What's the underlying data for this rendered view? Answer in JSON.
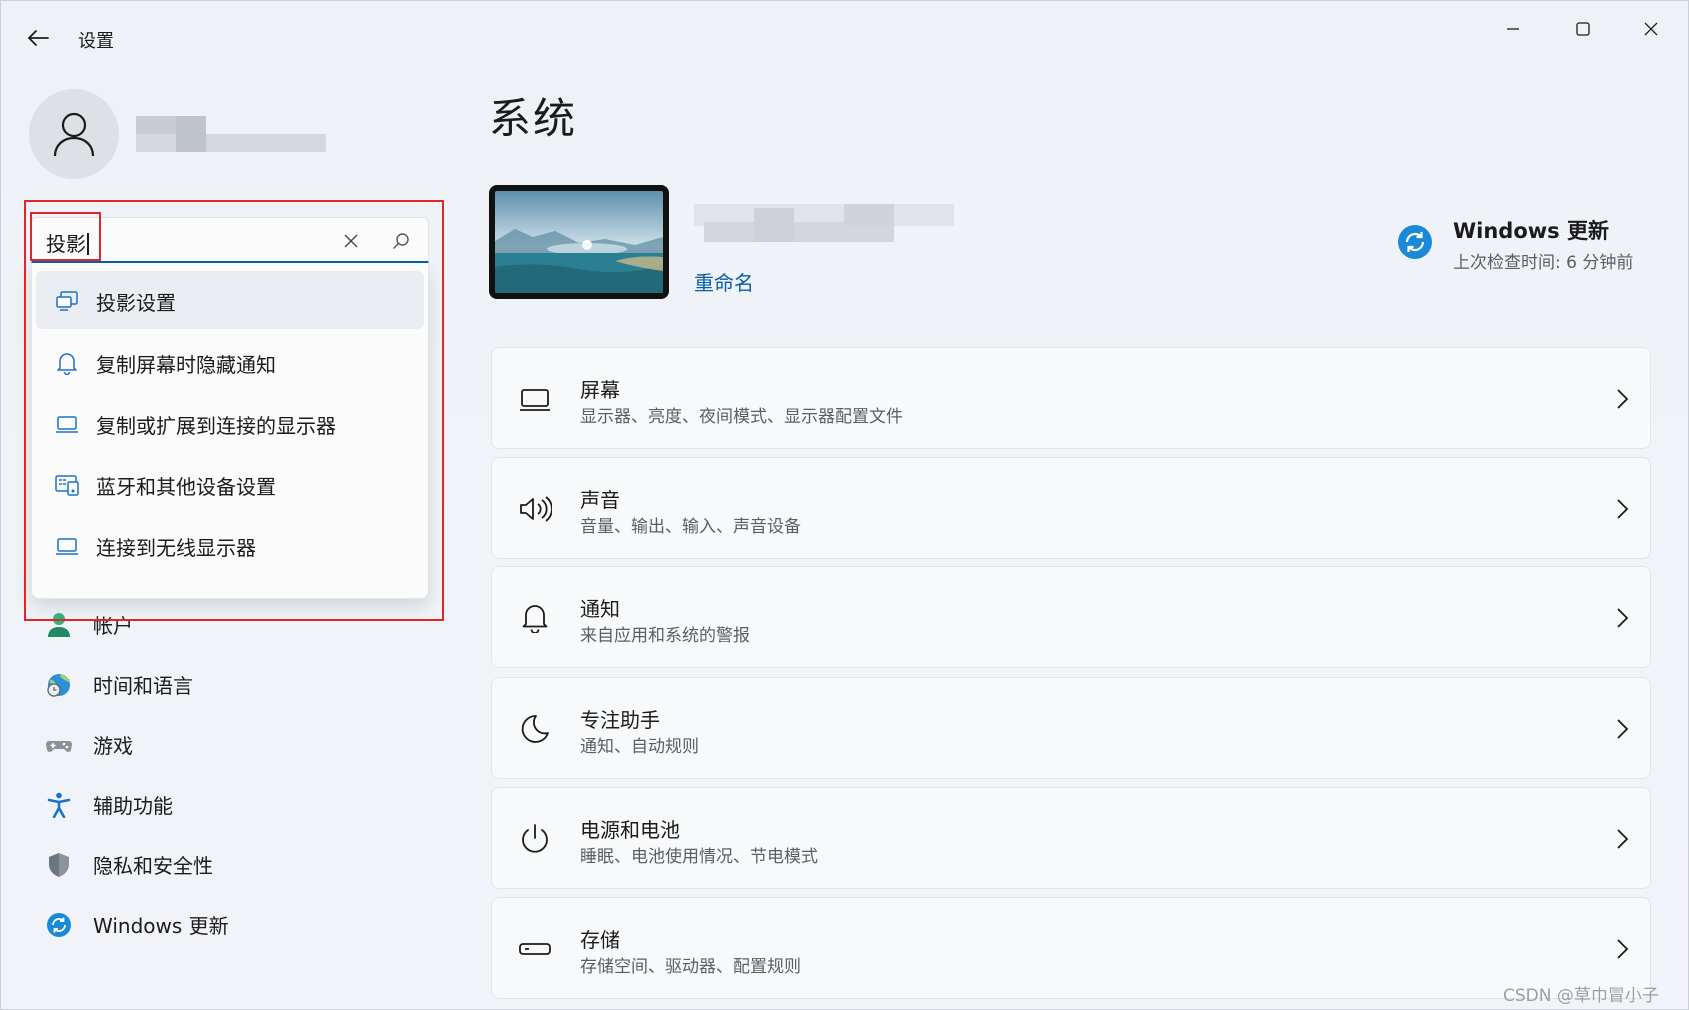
{
  "app": {
    "title": "设置"
  },
  "window_controls": {
    "minimize": "minimize-icon",
    "maximize": "maximize-icon",
    "close": "close-icon"
  },
  "search": {
    "value": "投影",
    "suggestions": [
      {
        "label": "投影设置",
        "icon": "project-icon",
        "active": true
      },
      {
        "label": "复制屏幕时隐藏通知",
        "icon": "bell-icon",
        "active": false
      },
      {
        "label": "复制或扩展到连接的显示器",
        "icon": "laptop-icon",
        "active": false
      },
      {
        "label": "蓝牙和其他设备设置",
        "icon": "devices-icon",
        "active": false
      },
      {
        "label": "连接到无线显示器",
        "icon": "laptop-icon",
        "active": false
      }
    ]
  },
  "sidebar": {
    "items": [
      {
        "label": "帐户",
        "icon": "account-icon"
      },
      {
        "label": "时间和语言",
        "icon": "globe-clock-icon"
      },
      {
        "label": "游戏",
        "icon": "gamepad-icon"
      },
      {
        "label": "辅助功能",
        "icon": "accessibility-icon"
      },
      {
        "label": "隐私和安全性",
        "icon": "shield-icon"
      },
      {
        "label": "Windows 更新",
        "icon": "update-icon"
      }
    ]
  },
  "main": {
    "title": "系统",
    "device": {
      "rename": "重命名"
    },
    "update": {
      "title": "Windows 更新",
      "subtitle": "上次检查时间: 6 分钟前"
    },
    "cards": [
      {
        "title": "屏幕",
        "subtitle": "显示器、亮度、夜间模式、显示器配置文件",
        "icon": "monitor-icon"
      },
      {
        "title": "声音",
        "subtitle": "音量、输出、输入、声音设备",
        "icon": "speaker-icon"
      },
      {
        "title": "通知",
        "subtitle": "来自应用和系统的警报",
        "icon": "bell-icon"
      },
      {
        "title": "专注助手",
        "subtitle": "通知、自动规则",
        "icon": "moon-icon"
      },
      {
        "title": "电源和电池",
        "subtitle": "睡眠、电池使用情况、节电模式",
        "icon": "power-icon"
      },
      {
        "title": "存储",
        "subtitle": "存储空间、驱动器、配置规则",
        "icon": "storage-icon"
      }
    ]
  },
  "watermark": "CSDN @草巾冒小子",
  "colors": {
    "accent": "#0a5fa8",
    "highlight": "#e1262a",
    "background": "#eef2f6"
  }
}
